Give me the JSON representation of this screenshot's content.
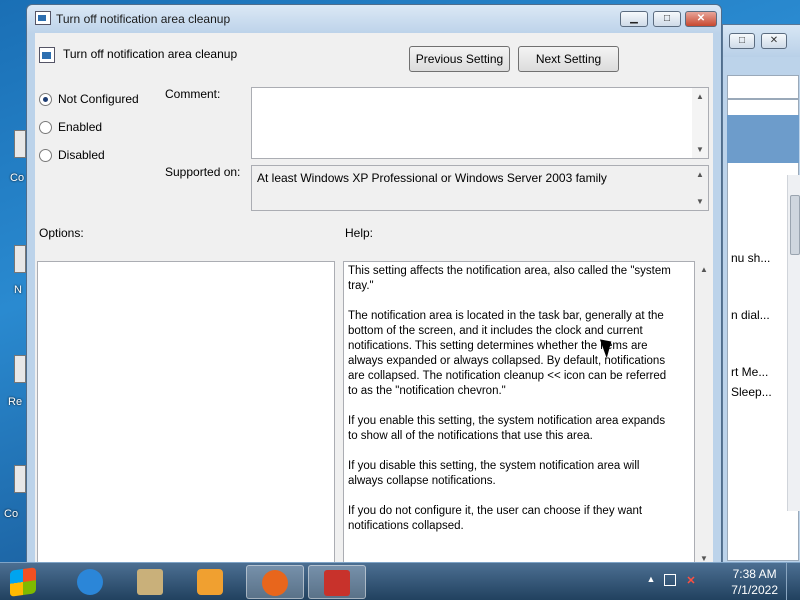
{
  "window": {
    "title": "Turn off notification area cleanup",
    "minimize_glyph": "▁",
    "maximize_glyph": "□",
    "close_glyph": "✕"
  },
  "header": {
    "title": "Turn off notification area cleanup",
    "previous_label": "Previous Setting",
    "next_label": "Next Setting"
  },
  "state": {
    "options": [
      {
        "label": "Not Configured",
        "selected": true
      },
      {
        "label": "Enabled",
        "selected": false
      },
      {
        "label": "Disabled",
        "selected": false
      }
    ]
  },
  "comment": {
    "label": "Comment:",
    "value": ""
  },
  "supported": {
    "label": "Supported on:",
    "value": "At least Windows XP Professional or Windows Server 2003 family"
  },
  "options_pane": {
    "label": "Options:"
  },
  "help_pane": {
    "label": "Help:",
    "paragraphs": [
      "This setting affects the notification area, also called the \"system tray.\"",
      "The notification area is located in the task bar, generally at the bottom of the screen, and it includes the clock and current notifications. This setting determines whether the items are always expanded or always collapsed. By default, notifications are collapsed. The notification cleanup << icon can be referred to as the \"notification chevron.\"",
      "If you enable this setting, the system notification area expands to show all of the notifications that use this area.",
      "If you disable this setting, the system notification area will always collapse notifications.",
      "If you do not configure it, the user can choose if they want notifications collapsed."
    ]
  },
  "background_window": {
    "items": [
      "nu sh...",
      "n dial...",
      "rt Me...",
      "Sleep..."
    ]
  },
  "desktop": {
    "labels": [
      "Co",
      "N",
      "Re",
      "Co"
    ]
  },
  "taskbar": {
    "apps": [
      {
        "name": "internet-explorer-icon",
        "color": "#2b86d8"
      },
      {
        "name": "file-manager-icon",
        "color": "#c9b07a"
      },
      {
        "name": "media-player-icon",
        "color": "#f0a030"
      },
      {
        "name": "firefox-icon",
        "color": "#e8661c"
      },
      {
        "name": "toolbox-icon",
        "color": "#c8322b"
      }
    ],
    "tray_chevron": "▲",
    "time": "7:38 AM",
    "date": "7/1/2022"
  }
}
